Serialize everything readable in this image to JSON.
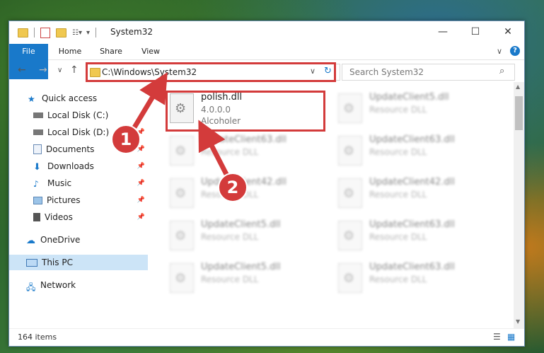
{
  "window": {
    "title": "System32",
    "controls": {
      "minimize": "—",
      "maximize": "☐",
      "close": "✕"
    }
  },
  "ribbon": {
    "tabs": [
      "File",
      "Home",
      "Share",
      "View"
    ],
    "expand_glyph": "∨",
    "help_glyph": "?"
  },
  "address": {
    "path": "C:\\Windows\\System32",
    "dropdown_glyph": "∨",
    "refresh_glyph": "↻"
  },
  "search": {
    "placeholder": "Search System32",
    "icon_glyph": "⌕"
  },
  "nav": {
    "back_glyph": "←",
    "forward_glyph": "→",
    "recent_glyph": "∨",
    "up_glyph": "↑"
  },
  "sidebar": {
    "items": [
      {
        "label": "Quick access",
        "icon": "star-icon",
        "pinned": false
      },
      {
        "label": "Local Disk (C:)",
        "icon": "drive-icon",
        "pinned": true
      },
      {
        "label": "Local Disk (D:)",
        "icon": "drive-icon",
        "pinned": true
      },
      {
        "label": "Documents",
        "icon": "documents-icon",
        "pinned": true
      },
      {
        "label": "Downloads",
        "icon": "downloads-icon",
        "pinned": true
      },
      {
        "label": "Music",
        "icon": "music-icon",
        "pinned": true
      },
      {
        "label": "Pictures",
        "icon": "pictures-icon",
        "pinned": true
      },
      {
        "label": "Videos",
        "icon": "videos-icon",
        "pinned": true
      },
      {
        "label": "OneDrive",
        "icon": "cloud-icon",
        "pinned": false
      },
      {
        "label": "This PC",
        "icon": "computer-icon",
        "pinned": false,
        "selected": true
      },
      {
        "label": "Network",
        "icon": "network-icon",
        "pinned": false
      }
    ]
  },
  "files": {
    "highlighted": {
      "name": "polish.dll",
      "version": "4.0.0.0",
      "company": "Alcoholer"
    },
    "blurred": [
      {
        "name": "UpdateClient5.dll",
        "type": "Resource DLL"
      },
      {
        "name": "UpdateClient63.dll",
        "type": "Resource DLL"
      },
      {
        "name": "UpdateClient63.dll",
        "type": "Resource DLL"
      },
      {
        "name": "UpdateClient42.dll",
        "type": "Resource DLL"
      },
      {
        "name": "UpdateClient42.dll",
        "type": "Resource DLL"
      },
      {
        "name": "UpdateClient5.dll",
        "type": "Resource DLL"
      },
      {
        "name": "UpdateClient63.dll",
        "type": "Resource DLL"
      },
      {
        "name": "UpdateClient5.dll",
        "type": "Resource DLL"
      },
      {
        "name": "UpdateClient63.dll",
        "type": "Resource DLL"
      }
    ]
  },
  "status": {
    "item_count": "164 items"
  },
  "callouts": [
    "1",
    "2"
  ],
  "colors": {
    "accent": "#1979ca",
    "highlight_red": "#d33b3b",
    "selected_bg": "#cce4f7"
  }
}
